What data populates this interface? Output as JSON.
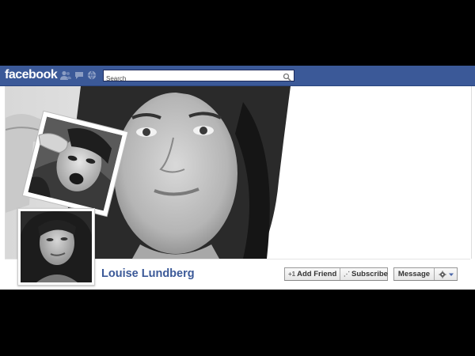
{
  "topbar": {
    "logo": "facebook",
    "search_placeholder": "Search",
    "bg_color": "#3b5998",
    "jewels": [
      "friend-requests-icon",
      "messages-icon",
      "notifications-icon"
    ]
  },
  "profile": {
    "name": "Louise Lundberg",
    "name_color": "#3b5998"
  },
  "actions": {
    "add_friend": "Add Friend",
    "subscribe": "Subscribe",
    "message": "Message",
    "settings_icon": "gear-icon"
  }
}
